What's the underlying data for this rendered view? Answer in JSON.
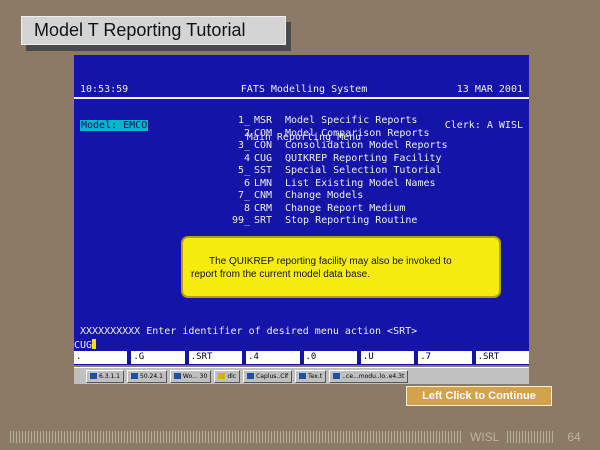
{
  "title": "Model T Reporting Tutorial",
  "screen": {
    "time": "10:53:59",
    "model_label": "Model: EMCO",
    "system_name": "FATS Modelling System",
    "menu_name": "Main Reporting Menu",
    "date": "13 MAR 2001",
    "clerk": "Clerk: A WISL",
    "menu_items": [
      {
        "num": "1_",
        "code": "MSR",
        "label": "Model Specific Reports"
      },
      {
        "num": "2",
        "code": "COM",
        "label": "Model Comparison Reports"
      },
      {
        "num": "3_",
        "code": "CON",
        "label": "Consolidation Model Reports"
      },
      {
        "num": "4",
        "code": "CUG",
        "label": "QUIKREP Reporting Facility"
      },
      {
        "num": "5_",
        "code": "SST",
        "label": "Special Selection Tutorial"
      },
      {
        "num": "6",
        "code": "LMN",
        "label": "List Existing Model Names"
      },
      {
        "num": "7_",
        "code": "CNM",
        "label": "Change Models"
      },
      {
        "num": "8",
        "code": "CRM",
        "label": "Change Report Medium"
      },
      {
        "num": "99_",
        "code": "SRT",
        "label": "Stop Reporting Routine"
      }
    ],
    "callout_line1": "The QUIKREP reporting facility may also be invoked to",
    "callout_line2": "report from the current model data base.",
    "prompt": "XXXXXXXXXX Enter identifier of desired menu action <SRT>",
    "command_value": "CUG",
    "command_keys": [
      ".",
      ".G",
      ".SRT",
      ".4",
      ".0",
      ".U",
      ".7",
      ".SRT"
    ]
  },
  "taskbar": [
    {
      "icon": "window-icon",
      "label": "6.3.1.1"
    },
    {
      "icon": "window-icon",
      "label": "50.24.1"
    },
    {
      "icon": "window-icon",
      "label": "Wo... 30"
    },
    {
      "icon": "folder-icon",
      "label": "dlc"
    },
    {
      "icon": "window-icon",
      "label": "Caplus..Clf"
    },
    {
      "icon": "window-icon",
      "label": "Tex.t"
    },
    {
      "icon": "window-icon",
      "label": "..ce...modu..lo..e4.3t"
    }
  ],
  "continue_label": "Left Click to Continue",
  "footer": {
    "org": "WISL",
    "page": "64"
  }
}
